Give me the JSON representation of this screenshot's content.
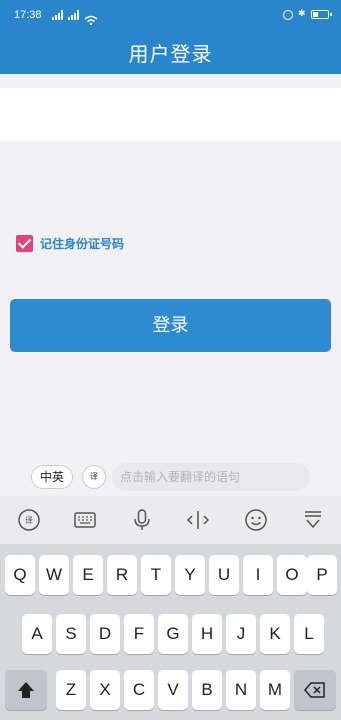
{
  "status_bar": {
    "time": "17:38"
  },
  "header": {
    "title": "用户登录"
  },
  "form": {
    "remember_label": "记住身份证号码",
    "login_label": "登录"
  },
  "translate_bar": {
    "lang_toggle": "中英",
    "icon_text": "译",
    "placeholder": "点击输入要翻译的语句"
  },
  "keyboard": {
    "row1": [
      "Q",
      "W",
      "E",
      "R",
      "T",
      "Y",
      "U",
      "I",
      "O",
      "P"
    ],
    "row2": [
      "A",
      "S",
      "D",
      "F",
      "G",
      "H",
      "J",
      "K",
      "L"
    ],
    "row3": [
      "Z",
      "X",
      "C",
      "V",
      "B",
      "N",
      "M"
    ]
  },
  "icons": {
    "toolbar": [
      "translate-icon",
      "keyboard-icon",
      "microphone-icon",
      "cursor-icon",
      "emoji-icon",
      "collapse-keyboard-icon"
    ],
    "shift": "shift-icon",
    "delete": "backspace-icon"
  },
  "colors": {
    "primary": "#2a86cb",
    "checkbox": "#e0447a"
  }
}
